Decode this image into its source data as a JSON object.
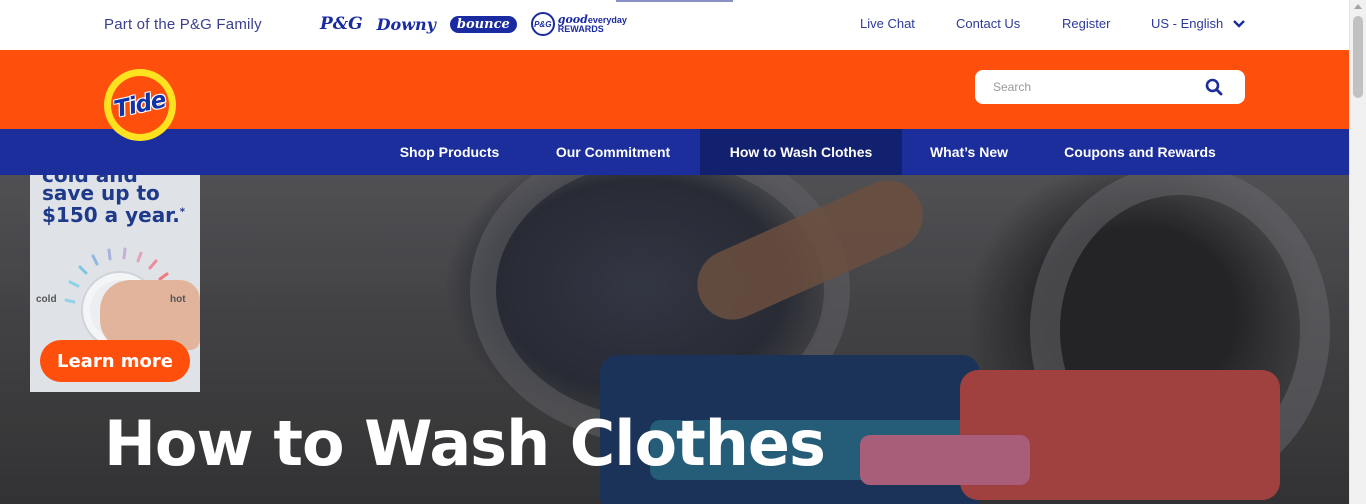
{
  "topbar": {
    "family_text": "Part of the P&G Family",
    "brands": [
      {
        "label": "P&G",
        "icon": "pg-logo-icon"
      },
      {
        "label": "Downy",
        "icon": "downy-logo-icon"
      },
      {
        "label": "bounce",
        "icon": "bounce-logo-icon"
      },
      {
        "label": "P&G good everyday REWARDS",
        "icon": "pg-rewards-logo-icon"
      }
    ],
    "rewards": {
      "badge": "P&G",
      "line1": "good",
      "line2": "everyday",
      "line3": "REWARDS"
    },
    "live_chat": "Live Chat",
    "contact_us": "Contact Us",
    "register": "Register",
    "language": "US - English"
  },
  "header": {
    "logo_text": "Tide",
    "search_placeholder": "Search"
  },
  "nav": {
    "items": [
      {
        "label": "Shop Products"
      },
      {
        "label": "Our Commitment"
      },
      {
        "label": "How to Wash Clothes",
        "active": true
      },
      {
        "label": "What’s New"
      },
      {
        "label": "Coupons and Rewards"
      }
    ]
  },
  "promo": {
    "line0": "cold and",
    "line1": "save up to",
    "line2": "$150 a year.",
    "footnote": "*",
    "cold": "cold",
    "hot": "hot",
    "button": "Learn more"
  },
  "hero": {
    "title": "How to Wash Clothes"
  },
  "colors": {
    "tide_orange": "#ff4f0c",
    "nav_blue": "#1b2e9c",
    "nav_active": "#11206f",
    "logo_yellow": "#ffe21f"
  }
}
